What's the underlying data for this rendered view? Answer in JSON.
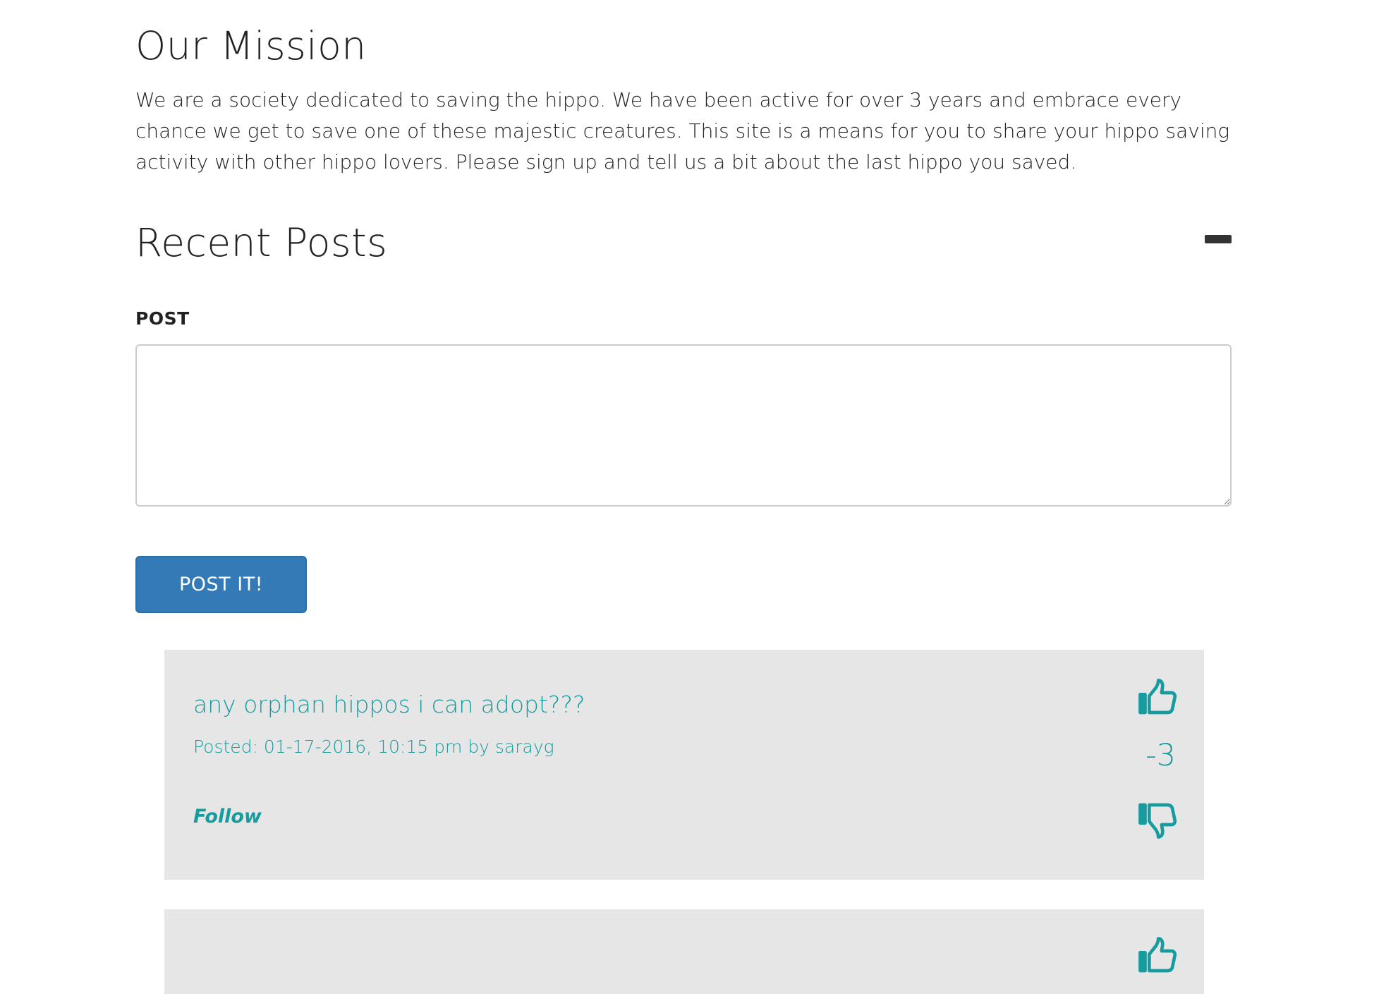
{
  "mission": {
    "title": "Our Mission",
    "text": "We are a society dedicated to saving the hippo. We have been active for over 3 years and embrace every chance we get to save one of these majestic creatures. This site is a means for you to share your hippo saving activity with other hippo lovers. Please sign up and tell us a bit about the last hippo you saved."
  },
  "recent_posts": {
    "title": "Recent Posts",
    "collapse_icon": "minus-icon"
  },
  "post_form": {
    "label": "POST",
    "textarea_value": "",
    "textarea_placeholder": "",
    "button_label": "POST IT!"
  },
  "colors": {
    "accent": "#169c9e",
    "button_primary": "#337ab7",
    "card_background": "#e6e6e6"
  },
  "posts": [
    {
      "title": "any orphan hippos i can adopt???",
      "meta": "Posted: 01-17-2016, 10:15 pm by sarayg",
      "follow_label": "Follow",
      "score": "-3",
      "upvote_icon": "thumbs-up-icon",
      "downvote_icon": "thumbs-down-icon"
    },
    {
      "title": "",
      "upvote_icon": "thumbs-up-icon"
    }
  ]
}
